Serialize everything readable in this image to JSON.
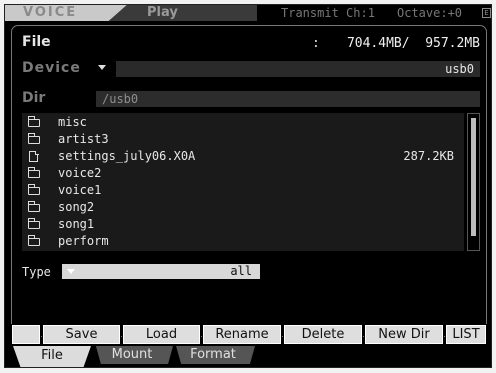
{
  "topbar": {
    "mode": "VOICE",
    "play": "Play",
    "transmit": "Transmit Ch:1",
    "octave": "Octave:+0",
    "status_icon": "E"
  },
  "file": {
    "label": "File",
    "colon": ":",
    "size": "704.4MB/  957.2MB"
  },
  "device": {
    "label": "Device",
    "value": "usb0"
  },
  "dir": {
    "label": "Dir",
    "value": "/usb0"
  },
  "list": [
    {
      "kind": "folder",
      "name": "misc",
      "size": ""
    },
    {
      "kind": "folder",
      "name": "artist3",
      "size": ""
    },
    {
      "kind": "file",
      "name": "settings_july06.X0A",
      "size": "287.2KB"
    },
    {
      "kind": "folder",
      "name": "voice2",
      "size": ""
    },
    {
      "kind": "folder",
      "name": "voice1",
      "size": ""
    },
    {
      "kind": "folder",
      "name": "song2",
      "size": ""
    },
    {
      "kind": "folder",
      "name": "song1",
      "size": ""
    },
    {
      "kind": "folder",
      "name": "perform",
      "size": ""
    }
  ],
  "type": {
    "label": "Type",
    "value": "all"
  },
  "buttons": {
    "save": "Save",
    "load": "Load",
    "rename": "Rename",
    "delete": "Delete",
    "newdir": "New Dir",
    "list": "LIST"
  },
  "tabs": {
    "file": "File",
    "mount": "Mount",
    "format": "Format"
  },
  "colors": {
    "screen_bg": "#000000",
    "button_bg": "#dedede",
    "field_bg": "#2a2a2a"
  }
}
